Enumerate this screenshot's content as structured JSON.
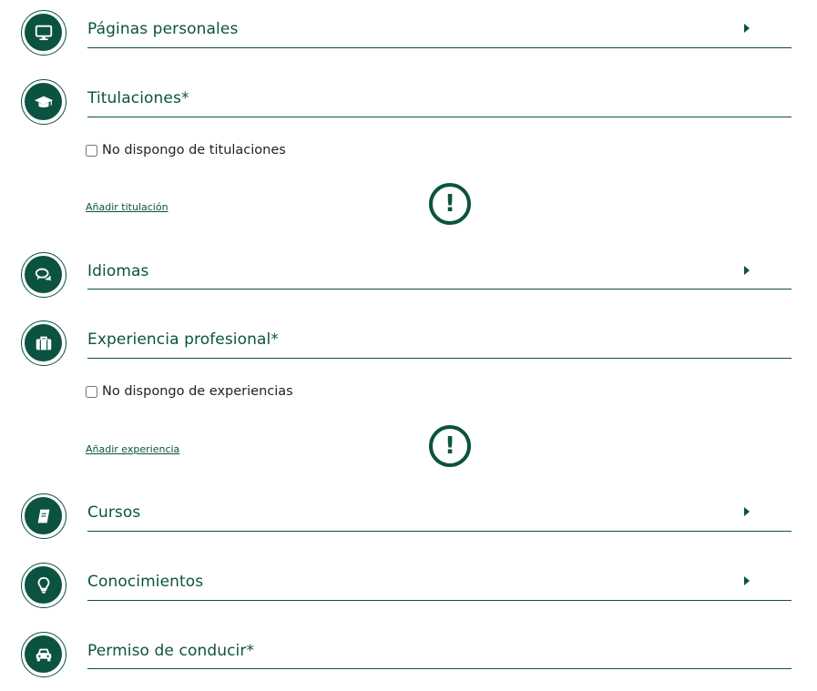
{
  "sections": {
    "paginas": {
      "title": "Páginas personales",
      "icon": "monitor-icon"
    },
    "titulaciones": {
      "title": "Titulaciones",
      "required": "*",
      "icon": "graduation-cap-icon",
      "checkbox_label": "No dispongo de titulaciones",
      "add_link": "Añadir titulación",
      "warning_symbol": "!"
    },
    "idiomas": {
      "title": "Idiomas",
      "icon": "speech-bubbles-icon"
    },
    "experiencia": {
      "title": "Experiencia profesional",
      "required": "*",
      "icon": "briefcase-icon",
      "checkbox_label": "No dispongo de experiencias",
      "add_link": "Añadir experiencia",
      "warning_symbol": "!"
    },
    "cursos": {
      "title": "Cursos",
      "icon": "book-icon"
    },
    "conocimientos": {
      "title": "Conocimientos",
      "icon": "lightbulb-icon"
    },
    "permiso": {
      "title": "Permiso de conducir",
      "required": "*",
      "icon": "car-icon"
    }
  },
  "colors": {
    "primary": "#0b5340",
    "text": "#222222",
    "background": "#ffffff"
  }
}
